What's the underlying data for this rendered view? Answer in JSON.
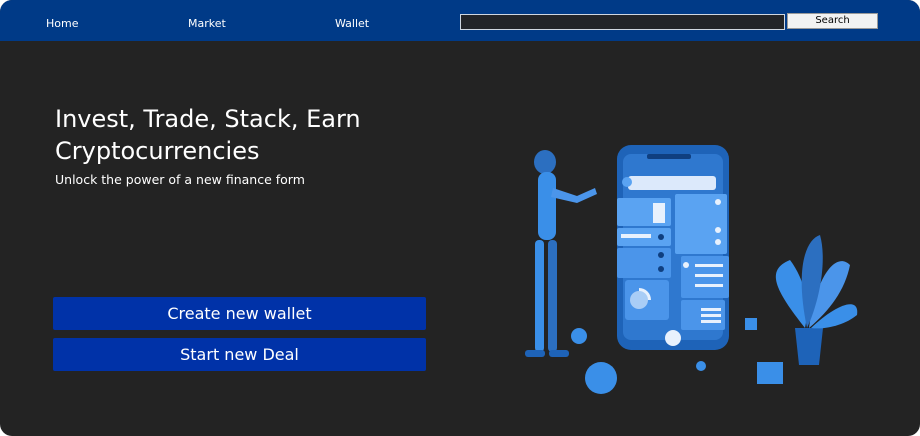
{
  "nav": {
    "links": [
      {
        "label": "Home"
      },
      {
        "label": "Market"
      },
      {
        "label": "Wallet"
      }
    ],
    "search": {
      "value": "",
      "placeholder": "",
      "button_label": "Search"
    }
  },
  "hero": {
    "title": "Invest, Trade, Stack, Earn Cryptocurrencies",
    "subtitle": "Unlock the power of a new finance form",
    "buttons": {
      "create_wallet": "Create new wallet",
      "start_deal": "Start new Deal"
    }
  },
  "illustration": {
    "description_icon": "person-with-phone-app-illustration"
  },
  "colors": {
    "navbar_bg": "#003a87",
    "page_bg": "#232323",
    "cta_bg": "#0032a8",
    "illustration_accent": "#3a8fe8"
  }
}
